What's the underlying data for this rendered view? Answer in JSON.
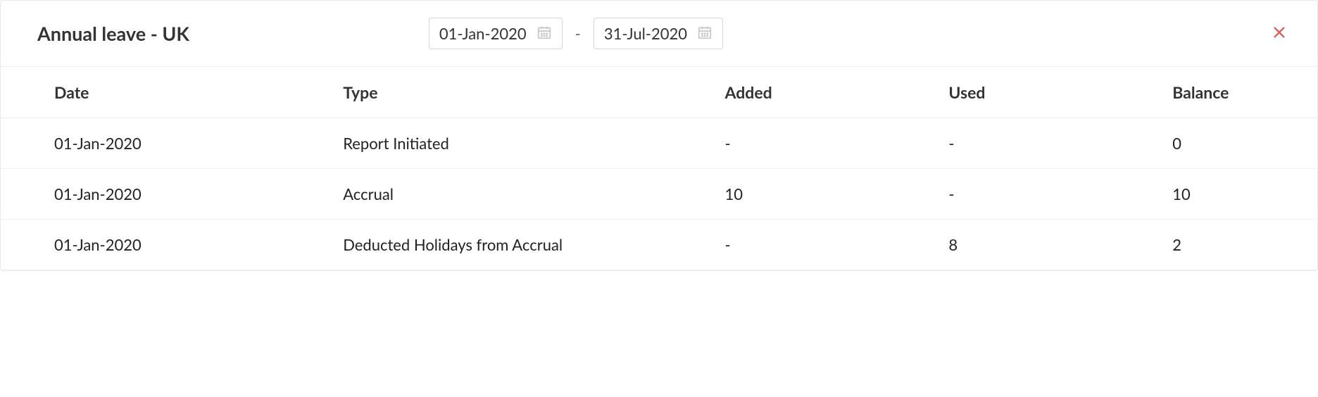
{
  "header": {
    "title": "Annual leave - UK",
    "date_from": "01-Jan-2020",
    "date_to": "31-Jul-2020",
    "range_separator": "-"
  },
  "table": {
    "columns": {
      "date": "Date",
      "type": "Type",
      "added": "Added",
      "used": "Used",
      "balance": "Balance"
    },
    "rows": [
      {
        "date": "01-Jan-2020",
        "type": "Report Initiated",
        "added": "-",
        "used": "-",
        "balance": "0"
      },
      {
        "date": "01-Jan-2020",
        "type": "Accrual",
        "added": "10",
        "used": "-",
        "balance": "10"
      },
      {
        "date": "01-Jan-2020",
        "type": "Deducted Holidays from Accrual",
        "added": "-",
        "used": "8",
        "balance": "2"
      }
    ]
  }
}
